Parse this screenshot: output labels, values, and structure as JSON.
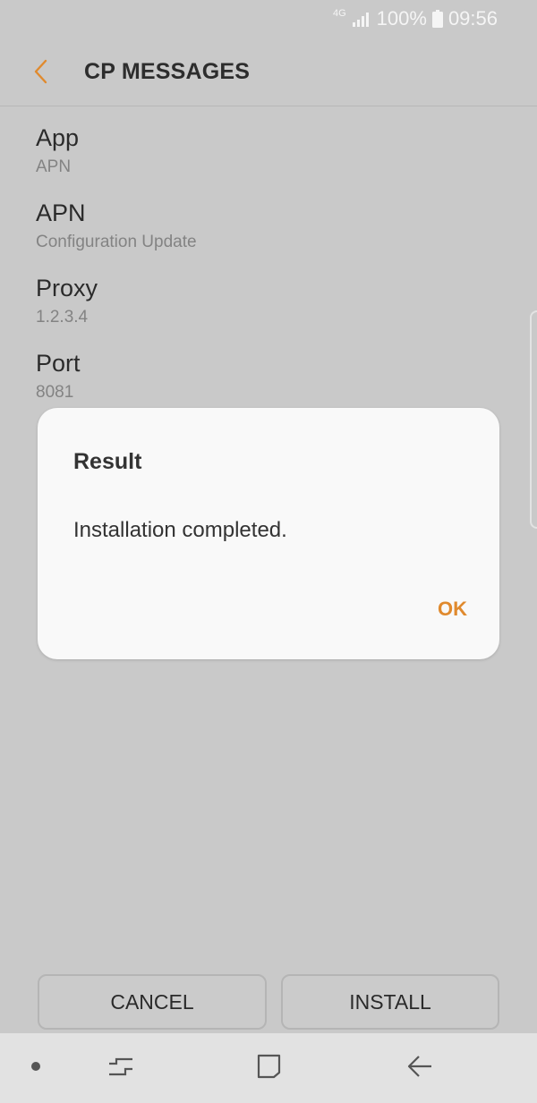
{
  "status_bar": {
    "network": "4G",
    "battery": "100%",
    "time": "09:56"
  },
  "app_bar": {
    "title": "CP MESSAGES",
    "back_icon": "chevron-left-icon",
    "accent_color": "#e08a2e"
  },
  "fields": [
    {
      "label": "App",
      "value": "APN"
    },
    {
      "label": "APN",
      "value": "Configuration Update"
    },
    {
      "label": "Proxy",
      "value": "1.2.3.4"
    },
    {
      "label": "Port",
      "value": "8081"
    }
  ],
  "dialog": {
    "title": "Result",
    "message": "Installation completed.",
    "ok_label": "OK"
  },
  "buttons": {
    "cancel_label": "CANCEL",
    "install_label": "INSTALL"
  },
  "nav_bar": {
    "items": [
      "dot-icon",
      "recents-icon",
      "home-icon",
      "back-icon"
    ]
  }
}
